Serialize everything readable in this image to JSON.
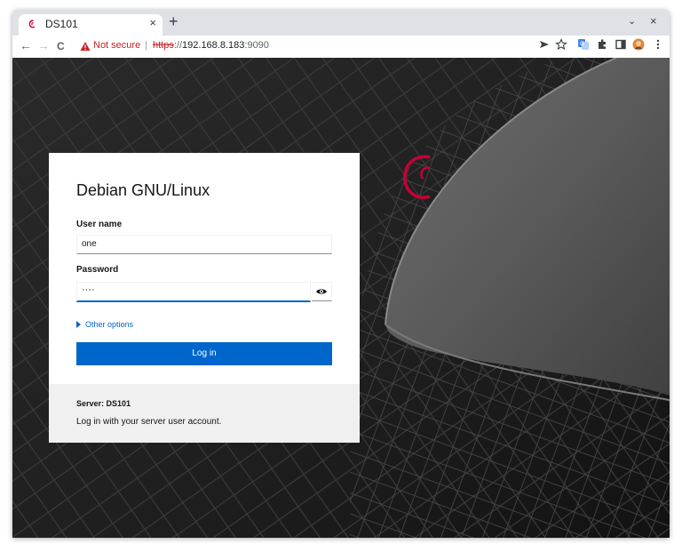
{
  "tab": {
    "title": "DS101",
    "close": "×",
    "new": "+"
  },
  "window": {
    "tabsearch": "⌄",
    "close": "×"
  },
  "toolbar": {
    "back": "←",
    "forward": "→",
    "reload": "C",
    "not_secure": "Not secure",
    "separator": "|",
    "url_scheme": "https",
    "url_sep": "://",
    "url_host": "192.168.8.183",
    "url_port": ":9090"
  },
  "login": {
    "heading": "Debian GNU/Linux",
    "username_label": "User name",
    "username_value": "one",
    "password_label": "Password",
    "password_value": "····",
    "other_options": "Other options",
    "login_button": "Log in"
  },
  "footer": {
    "server": "Server: DS101",
    "note": "Log in with your server user account."
  },
  "colors": {
    "accent": "#0066cc",
    "warning": "#c5221f",
    "debian_red": "#c70036"
  }
}
